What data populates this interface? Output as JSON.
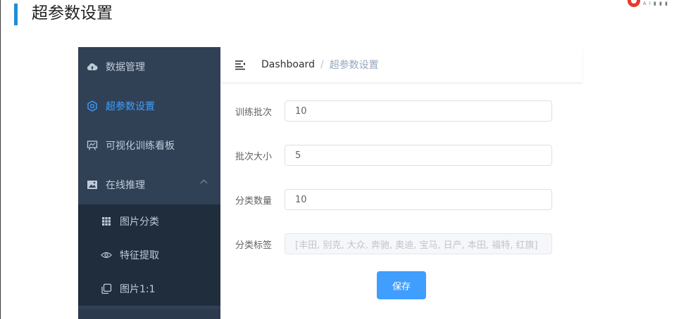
{
  "slide": {
    "title": "超参数设置",
    "logo_text": "A I ▮ ▮ ▮"
  },
  "sidebar": {
    "items": [
      {
        "label": "数据管理",
        "icon": "cloud-upload-icon",
        "active": false
      },
      {
        "label": "超参数设置",
        "icon": "gear-icon",
        "active": true
      },
      {
        "label": "可视化训练看板",
        "icon": "chart-board-icon",
        "active": false
      },
      {
        "label": "在线推理",
        "icon": "image-icon",
        "active": false,
        "expanded": true
      }
    ],
    "submenu": [
      {
        "label": "图片分类",
        "icon": "grid-icon"
      },
      {
        "label": "特征提取",
        "icon": "eye-icon"
      },
      {
        "label": "图片1:1",
        "icon": "copy-icon"
      }
    ]
  },
  "navbar": {
    "breadcrumb_home": "Dashboard",
    "breadcrumb_sep": "/",
    "breadcrumb_current": "超参数设置"
  },
  "form": {
    "epochs_label": "训练批次",
    "epochs_value": "10",
    "batch_label": "批次大小",
    "batch_value": "5",
    "classes_label": "分类数量",
    "classes_value": "10",
    "tags_label": "分类标签",
    "tags_value": "[丰田, 别克, 大众, 奔驰, 奥迪, 宝马, 日产, 本田, 福特, 红旗]",
    "save_label": "保存"
  },
  "colors": {
    "sidebar_bg": "#304156",
    "submenu_bg": "#1f2d3d",
    "accent": "#409eff",
    "title_bar": "#1f8fd6"
  }
}
